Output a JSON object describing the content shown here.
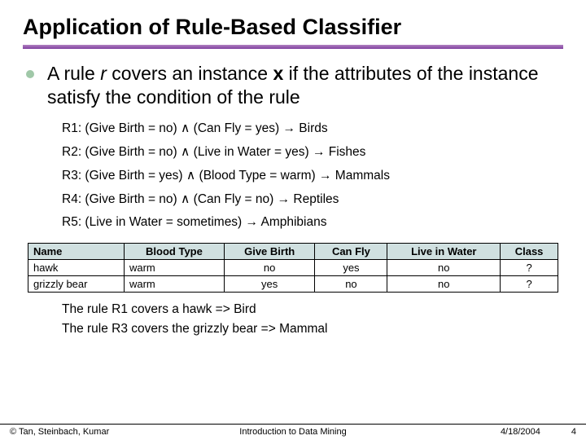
{
  "title": "Application of Rule-Based Classifier",
  "bullet": {
    "prefix": "A rule ",
    "r": "r",
    "mid1": " covers an instance ",
    "x": "x",
    "mid2": " if the attributes of the instance satisfy the condition of the rule"
  },
  "rules": [
    "R1: (Give Birth = no) ∧ (Can Fly = yes) → Birds",
    "R2: (Give Birth = no) ∧ (Live in Water = yes) → Fishes",
    "R3: (Give Birth = yes) ∧ (Blood Type = warm) → Mammals",
    "R4: (Give Birth = no) ∧ (Can Fly = no) → Reptiles",
    "R5: (Live in Water = sometimes) → Amphibians"
  ],
  "table": {
    "headers": [
      "Name",
      "Blood Type",
      "Give Birth",
      "Can Fly",
      "Live in Water",
      "Class"
    ],
    "rows": [
      [
        "hawk",
        "warm",
        "no",
        "yes",
        "no",
        "?"
      ],
      [
        "grizzly bear",
        "warm",
        "yes",
        "no",
        "no",
        "?"
      ]
    ]
  },
  "conclusions": [
    "The rule R1 covers a hawk => Bird",
    "The rule R3 covers the grizzly bear => Mammal"
  ],
  "footer": {
    "left": "© Tan, Steinbach, Kumar",
    "center": "Introduction to Data Mining",
    "date": "4/18/2004",
    "page": "4"
  }
}
